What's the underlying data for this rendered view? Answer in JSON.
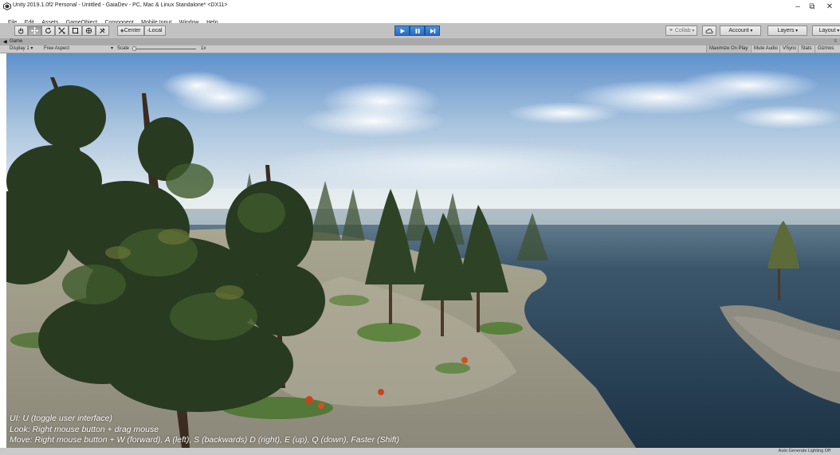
{
  "window": {
    "title": "Unity 2019.1.0f2 Personal - Untitled - GaiaDev - PC, Mac & Linux Standalone* <DX11>",
    "minimize": "–",
    "maximize": "⧉",
    "close": "✕"
  },
  "menu": [
    "File",
    "Edit",
    "Assets",
    "GameObject",
    "Component",
    "Mobile Input",
    "Window",
    "Help"
  ],
  "toolbar": {
    "tools": [
      "hand-tool-icon",
      "move-tool-icon",
      "rotate-tool-icon",
      "scale-tool-icon",
      "rect-tool-icon",
      "transform-tool-icon",
      "custom-tool-icon"
    ],
    "pivot_label": "Center",
    "space_label": "Local",
    "collab_label": "Collab",
    "account_label": "Account",
    "layers_label": "Layers",
    "layout_label": "Layout"
  },
  "game_tab": {
    "label": "Game"
  },
  "game_toolbar": {
    "display": "Display 1",
    "aspect": "Free Aspect",
    "scale_label": "Scale",
    "scale_value": "1x",
    "maximize_on_play": "Maximize On Play",
    "mute_audio": "Mute Audio",
    "vsync": "VSync",
    "stats": "Stats",
    "gizmos": "Gizmos"
  },
  "viewport": {
    "help_lines": [
      "UI: U (toggle user interface)",
      "Look: Right mouse button + drag mouse",
      "Move: Right mouse button + W (forward), A (left), S (backwards) D (right), E (up), Q (down), Faster (Shift)"
    ]
  },
  "status": {
    "lighting": "Auto Generate Lighting Off"
  },
  "colors": {
    "sky_top": "#6f9fd4",
    "sky_horizon": "#eef3f4",
    "water": "#253e54",
    "terrain": "#9d9a8a",
    "tree_dark": "#2b3a24",
    "play_accent": "#2a6cc0"
  }
}
